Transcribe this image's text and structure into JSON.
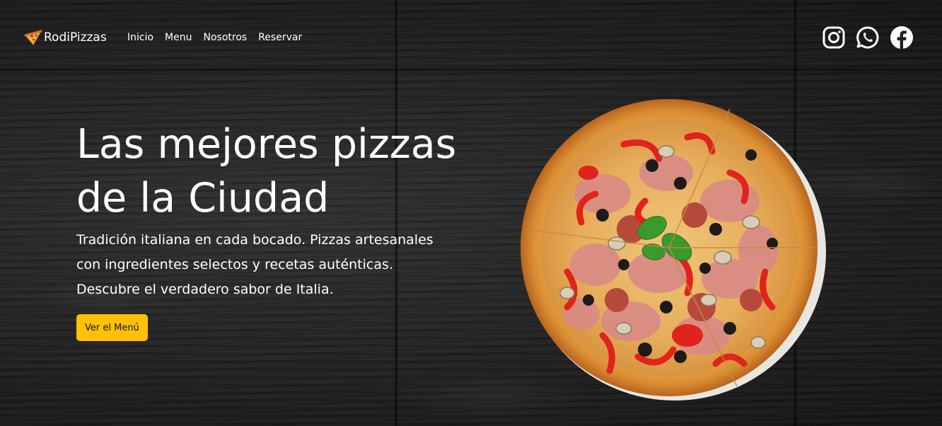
{
  "brand": {
    "name": "RodiPizzas",
    "logo_icon": "pizza-slice-icon"
  },
  "nav": {
    "links": [
      {
        "label": "Inicio"
      },
      {
        "label": "Menu"
      },
      {
        "label": "Nosotros"
      },
      {
        "label": "Reservar"
      }
    ]
  },
  "social": [
    {
      "icon": "instagram-icon"
    },
    {
      "icon": "whatsapp-icon"
    },
    {
      "icon": "facebook-icon"
    }
  ],
  "hero": {
    "title_line1": "Las mejores pizzas",
    "title_line2": "de la Ciudad",
    "subtitle": "Tradición italiana en cada bocado. Pizzas artesanales con ingredientes selectos y recetas auténticas. Descubre el verdadero sabor de Italia.",
    "cta_label": "Ver el Menú",
    "image": "pizza-image"
  },
  "colors": {
    "accent": "#ffc107",
    "background": "#1f1f1f",
    "text": "#ffffff"
  }
}
